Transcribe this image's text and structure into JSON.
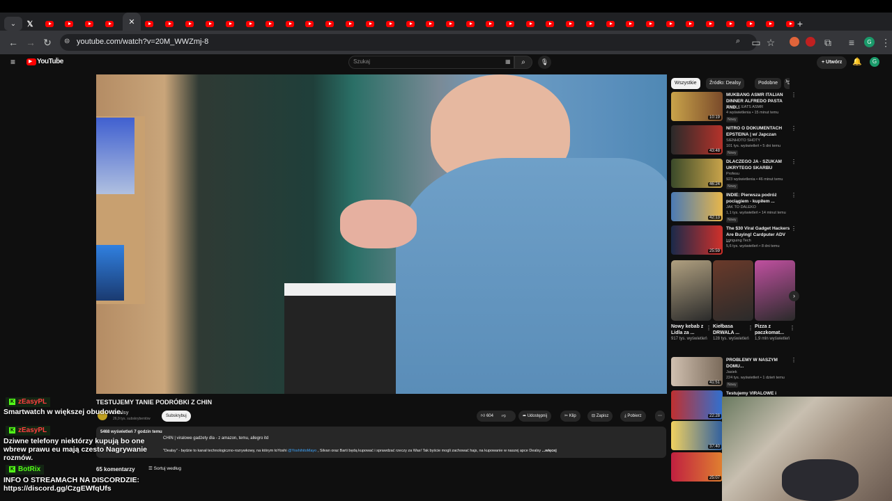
{
  "browser": {
    "url": "youtube.com/watch?v=20M_WWZmj-8",
    "new_tab_label": "+"
  },
  "youtube": {
    "logo": "YouTube",
    "logo_region": "PL",
    "search_placeholder": "Szukaj",
    "create_label": "Utwórz",
    "avatar_letter": "G"
  },
  "video": {
    "title": "TESTUJEMY TANIE PODRÓBKI Z CHIN",
    "channel_name": "Dealsy",
    "subscribers": "26,9 tys. subskrybentów",
    "subscribe_label": "Subskrybuj",
    "likes": "604",
    "share_label": "Udostępnij",
    "clip_label": "Klip",
    "save_label": "Zapisz",
    "download_label": "Pobierz",
    "views_time": "5468 wyświetleń  7 godzin temu",
    "desc_line1": "CHIN | viralowe gadżety dla - z amazon, temu, allegro itd",
    "desc_line2": "\"Dealsy\" - będzie to kanał technologiczno-rozrywkowy, na którym toYoshi",
    "desc_link": "@YoshihitoMayo",
    "desc_line2b": ", Silvan oraz Barti będą kupować i sprawdzać rzeczy za Was! Tak byście mogli zachować hajs, na kupowanie w naszej apce Dealsy ",
    "more_label": "...więcej",
    "comments_count": "65 komentarzy",
    "sort_label": "Sortuj według"
  },
  "chips": [
    "Wszystkie",
    "Źródło: Dealsy",
    "Podobne",
    "Dla"
  ],
  "recommendations": [
    {
      "title": "MUKBANG ASMR ITALIAN DINNER ALFREDO PASTA AND...",
      "channel": "M and K EATS ASMR",
      "meta": "4 wyświetlenia • 15 minut temu",
      "badge": "Nowy",
      "duration": "10:19",
      "colors": [
        "#c9a34a",
        "#7a4a2a"
      ]
    },
    {
      "title": "NITRO O DOKUMENTACH EPSTEINA | w/ Japczan",
      "channel": "SIENHOTO SHOTY",
      "meta": "101 tys. wyświetleń • 5 dni temu",
      "badge": "Nowy",
      "duration": "43:48",
      "colors": [
        "#2a2a2a",
        "#b5322a"
      ]
    },
    {
      "title": "DLACZEGO JA - SZUKAM UKRYTEGO SKARBU",
      "channel": "Profesu",
      "meta": "923 wyświetlenia • 46 minut temu",
      "badge": "Nowy",
      "duration": "46:24",
      "colors": [
        "#3a4a2a",
        "#c9a34a"
      ]
    },
    {
      "title": "INDIE: Pierwsza podróż pociągiem - kupiłem ...",
      "channel": "JAK TO DALEKO",
      "meta": "1,1 tys. wyświetleń • 14 minut temu",
      "badge": "Nowy",
      "duration": "42:13",
      "colors": [
        "#4a7ab5",
        "#e8b64a"
      ]
    },
    {
      "title": "The $30 Viral Gadget Hackers Are Buying! Cardputer ADV ...",
      "channel": "Intriguing Tech",
      "meta": "5,6 tys. wyświetleń • 8 dni temu",
      "badge": "",
      "duration": "25:59",
      "colors": [
        "#1a2a4a",
        "#d0302a"
      ]
    }
  ],
  "shorts": [
    {
      "title": "Nowy kebab z Lidla za ...",
      "views": "917 tys. wyświetleń",
      "color": "#b0a080"
    },
    {
      "title": "Kiełbasa DRWALA ...",
      "views": "128 tys. wyświetleń",
      "color": "#6a3a2a"
    },
    {
      "title": "Pizza z paczkomat...",
      "views": "1,9 mln wyświetleń",
      "color": "#c050a0"
    }
  ],
  "lower_rec": {
    "title": "PROBLEMY W NASZYM DOMU...",
    "channel": "Jasiek",
    "meta": "224 tys. wyświetleń • 1 dzień temu",
    "badge": "Nowy",
    "duration": "41:51"
  },
  "lower_rec2_title": "Testujemy VIRALOWE i TANIE",
  "side_thumbs": [
    {
      "duration": "22:28"
    },
    {
      "duration": "37:40"
    },
    {
      "duration": "25:07"
    }
  ],
  "chat": [
    {
      "name": "zEasyPL",
      "message": "Smartwatch w większej obudowie.",
      "name_color": "#ff4040"
    },
    {
      "name": "zEasyPL",
      "message": "Dziwne telefony niektórzy kupują bo one wbrew prawu eu mają czesto Nagrywanie rozmów.",
      "name_color": "#ff4040"
    },
    {
      "name": "BotRix",
      "message": "INFO O STREAMACH NA DISCORDZIE: https://discord.gg/CzgEWfqUfs",
      "name_color": "#53fc18"
    }
  ]
}
